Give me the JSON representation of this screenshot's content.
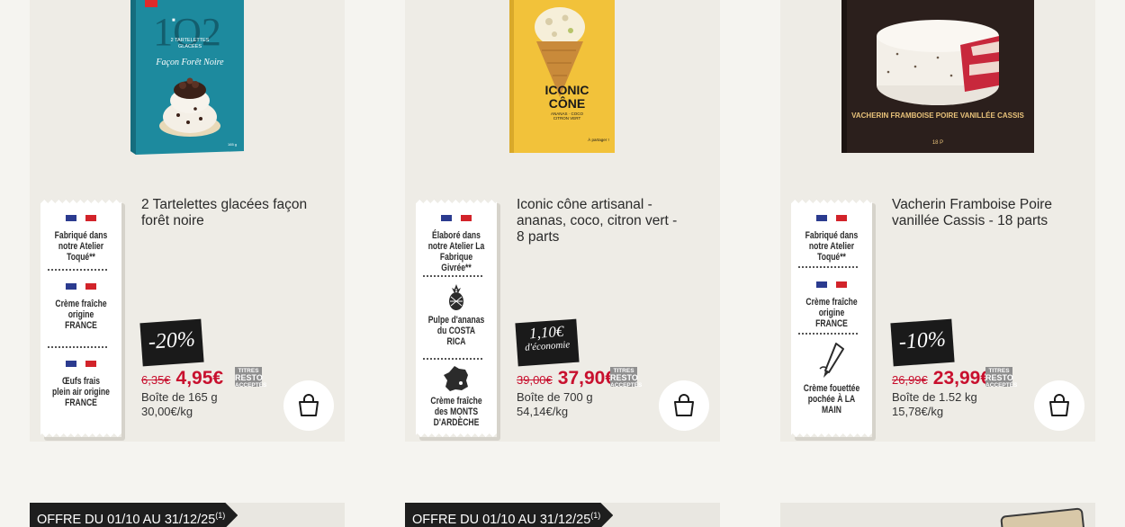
{
  "products": [
    {
      "title": "2 Tartelettes glacées façon forêt noire",
      "tag": [
        {
          "flag": true,
          "text": "Fabriqué dans notre Atelier Toqué**"
        },
        {
          "flag": true,
          "text": "Crème fraîche origine FRANCE"
        },
        {
          "flag": true,
          "text": "Œufs frais plein air origine FRANCE"
        }
      ],
      "promo": "-20%",
      "old_price": "6,35€",
      "new_price": "4,95€",
      "resto_top": "TITRES",
      "resto_mid": "RESTO",
      "resto_bot": "ACCEPTÉS",
      "pack": "Boîte de 165 g",
      "per_kg": "30,00€/kg",
      "box_color": "#1d8a9e",
      "box_text_big": "1 0 2",
      "box_text_small": "2 TARTELETTES GLACÉES",
      "box_script": "Façon Forêt Noire"
    },
    {
      "title": "Iconic cône artisanal - ananas, coco, citron vert - 8 parts",
      "tag": [
        {
          "flag": true,
          "text": "Élaboré dans notre Atelier La Fabrique Givrée**"
        },
        {
          "flag": false,
          "icon": "pineapple-icon",
          "text": "Pulpe d'ananas du COSTA RICA"
        },
        {
          "flag": false,
          "icon": "france-map-icon",
          "text": "Crème fraîche des MONTS D'ARDÈCHE"
        }
      ],
      "promo_line1": "1,10€",
      "promo_line2": "d'économie",
      "old_price": "39,00€",
      "new_price": "37,90€",
      "resto_top": "TITRES",
      "resto_mid": "RESTO",
      "resto_bot": "ACCEPTÉS",
      "pack": "Boîte de 700 g",
      "per_kg": "54,14€/kg",
      "box_color": "#f2c23a",
      "box_text_big": "ICONIC CÔNE",
      "box_text_small": "ANANAS · COCO CITRON VERT",
      "box_note": "À partager !"
    },
    {
      "title": "Vacherin Framboise Poire vanillée Cassis - 18 parts",
      "tag": [
        {
          "flag": true,
          "text": "Fabriqué dans notre Atelier Toqué**"
        },
        {
          "flag": true,
          "text": "Crème fraîche origine FRANCE"
        },
        {
          "flag": false,
          "icon": "piping-bag-icon",
          "text": "Crème fouettée pochée À LA MAIN"
        }
      ],
      "promo": "-10%",
      "old_price": "26,99€",
      "new_price": "23,99€",
      "resto_top": "TITRES",
      "resto_mid": "RESTO",
      "resto_bot": "ACCEPTÉS",
      "pack": "Boîte de 1.52 kg",
      "per_kg": "15,78€/kg",
      "box_color": "#2b1f1c",
      "box_text_big": "VACHERIN FRAMBOISE POIRE VANILLÉE CASSIS",
      "box_note": "18 P"
    }
  ],
  "offers": [
    {
      "text": "OFFRE DU 01/10 AU 31/12/25",
      "sup": "(1)"
    },
    {
      "text": "OFFRE DU 01/10 AU 31/12/25",
      "sup": "(1)"
    }
  ]
}
